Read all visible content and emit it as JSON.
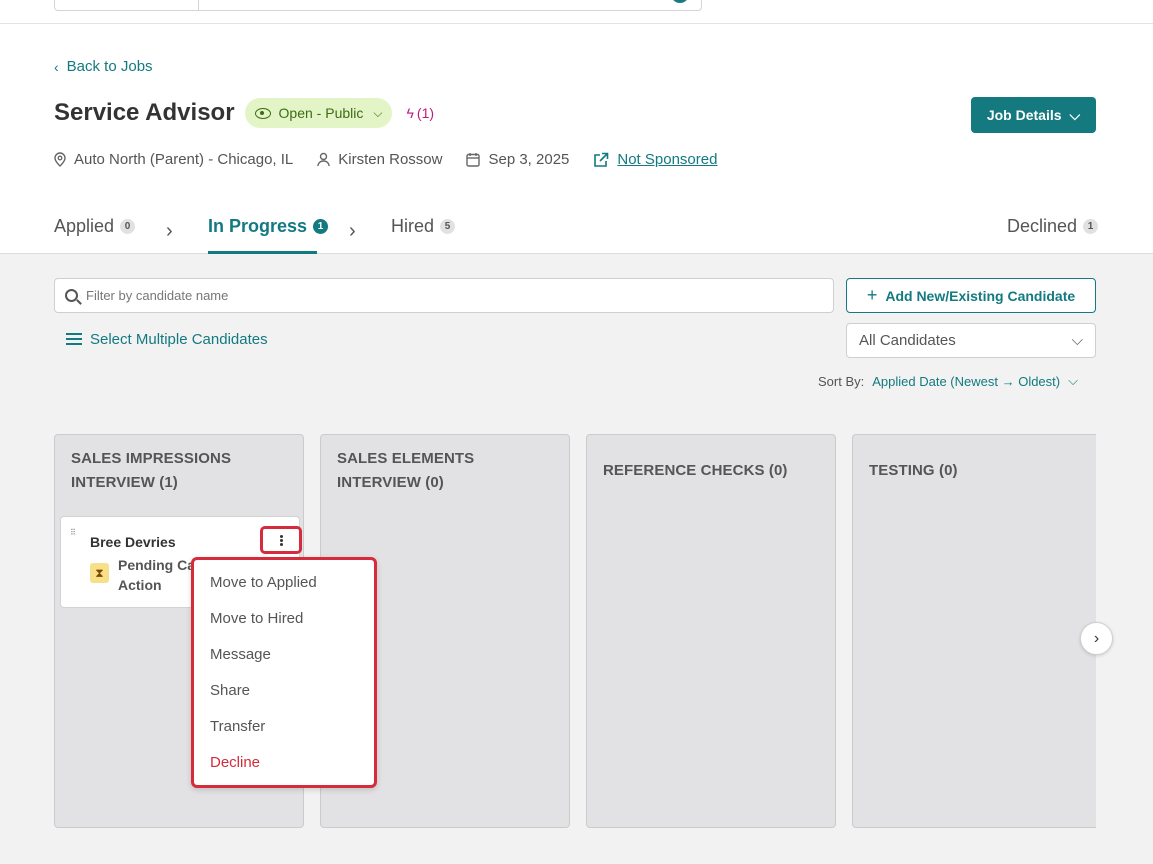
{
  "back_link": "Back to Jobs",
  "job": {
    "title": "Service Advisor",
    "status": "Open - Public",
    "boost": "(1)",
    "details_button": "Job Details",
    "location": "Auto North (Parent) - Chicago, IL",
    "recruiter": "Kirsten Rossow",
    "date": "Sep 3, 2025",
    "sponsorship": "Not Sponsored"
  },
  "tabs": [
    {
      "label": "Applied",
      "count": "0"
    },
    {
      "label": "In Progress",
      "count": "1"
    },
    {
      "label": "Hired",
      "count": "5"
    },
    {
      "label": "Declined",
      "count": "1"
    }
  ],
  "toolbar": {
    "search_placeholder": "Filter by candidate name",
    "add_candidate": "Add New/Existing Candidate",
    "select_multiple": "Select Multiple Candidates",
    "candidate_filter": "All Candidates",
    "sort_label": "Sort By:",
    "sort_value": "Applied Date (Newest → Oldest)"
  },
  "columns": [
    {
      "line1": "SALES IMPRESSIONS",
      "line2": "INTERVIEW (1)"
    },
    {
      "line1": "SALES ELEMENTS",
      "line2": "INTERVIEW (0)"
    },
    {
      "line1": "REFERENCE CHECKS (0)",
      "line2": ""
    },
    {
      "line1": "TESTING (0)",
      "line2": ""
    }
  ],
  "candidate": {
    "name": "Bree Devries",
    "status_line1": "Pending Can",
    "status_line2": "Action"
  },
  "context_menu": [
    "Move to Applied",
    "Move to Hired",
    "Message",
    "Share",
    "Transfer",
    "Decline"
  ],
  "colors": {
    "accent": "#127a80",
    "danger": "#d42b3b",
    "status_bg": "#e3f5c6"
  }
}
